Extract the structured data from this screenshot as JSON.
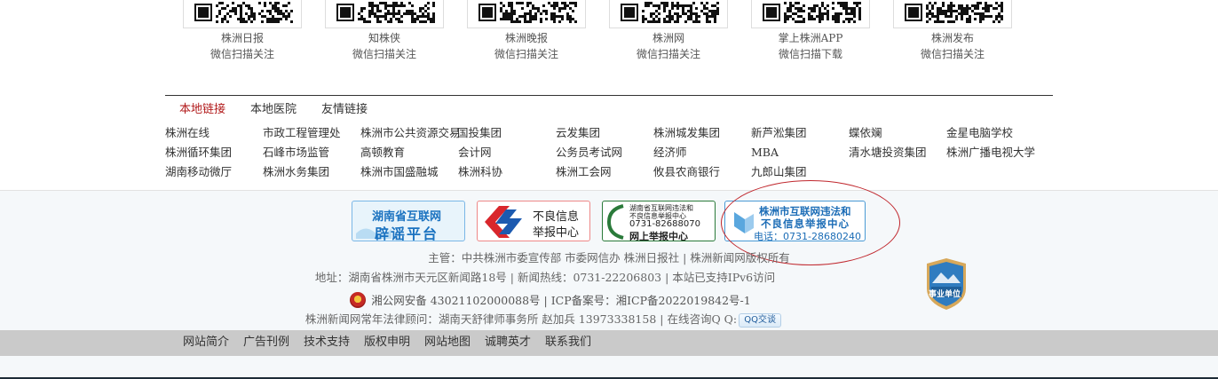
{
  "qr_items": [
    {
      "name": "株洲日报",
      "action": "微信扫描关注"
    },
    {
      "name": "知株侠",
      "action": "微信扫描关注"
    },
    {
      "name": "株洲晚报",
      "action": "微信扫描关注"
    },
    {
      "name": "株洲网",
      "action": "微信扫描关注"
    },
    {
      "name": "掌上株洲APP",
      "action": "微信扫描下载"
    },
    {
      "name": "株洲发布",
      "action": "微信扫描关注"
    }
  ],
  "link_tabs": [
    {
      "label": "本地链接",
      "active": true
    },
    {
      "label": "本地医院",
      "active": false
    },
    {
      "label": "友情链接",
      "active": false
    }
  ],
  "links": [
    [
      "株洲在线",
      "市政工程管理处",
      "株洲市公共资源交易",
      "国投集团",
      "云发集团",
      "株洲城发集团",
      "新芦淞集团",
      "蝶依斓",
      "金星电脑学校"
    ],
    [
      "株洲循环集团",
      "石峰市场监管",
      "高顿教育",
      "会计网",
      "公务员考试网",
      "经济师",
      "MBA",
      "清水塘投资集团",
      "株洲广播电视大学"
    ],
    [
      "湖南移动微厅",
      "株洲水务集团",
      "株洲市国盛融城",
      "株洲科协",
      "株洲工会网",
      "攸县农商银行",
      "九郎山集团"
    ]
  ],
  "badges": {
    "rumor": {
      "line1": "湖南省互联网",
      "line2": "辟谣平台"
    },
    "bad_info": {
      "line1": "不良信息",
      "line2": "举报中心"
    },
    "online_report": {
      "line1": "湖南省互联网违法和",
      "line2": "不良信息举报中心",
      "phone": "0731-82688070",
      "line3": "网上举报中心"
    },
    "zhuzhou_report": {
      "line1": "株洲市互联网违法和",
      "line2": "不良信息举报中心",
      "phone": "电话：0731-28680240"
    }
  },
  "footer_info": {
    "line1": "主管：中共株洲市委宣传部 市委网信办 株洲日报社 | 株洲新闻网版权所有",
    "line2": "地址：湖南省株洲市天元区新闻路18号 | 新闻热线：0731-22206803 | 本站已支持IPv6访问",
    "line3": "湘公网安备 43021102000088号 | ICP备案号：湘ICP备2022019842号-1",
    "line4": "株洲新闻网常年法律顾问：湖南天舒律师事务所 赵加兵 13973338158  | 在线咨询Q Q:",
    "qq_label": "QQ交谈",
    "shield_label": "事业单位"
  },
  "bottom_nav": [
    "网站简介",
    "广告刊例",
    "技术支持",
    "版权申明",
    "网站地图",
    "诚聘英才",
    "联系我们"
  ],
  "colors": {
    "accent_red": "#b1191a",
    "nav_bg": "#cacaca",
    "footer_bg": "#f5f8fa"
  }
}
